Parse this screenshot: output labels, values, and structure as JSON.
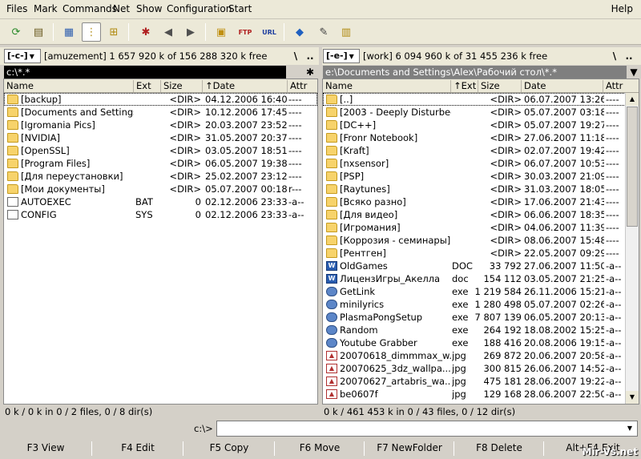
{
  "menu": [
    "Files",
    "Mark",
    "Commands",
    "Net",
    "Show",
    "Configuration",
    "Start"
  ],
  "menu_help": "Help",
  "left": {
    "drive": "[-c-]",
    "info": "[amuzement]  1 657 920 k of 156 288 320 k free",
    "path": "c:\\*.*",
    "columns": [
      "Name",
      "Ext",
      "Size",
      "↑Date",
      "Attr"
    ],
    "rows": [
      {
        "name": "[backup]",
        "ext": "",
        "size": "<DIR>",
        "date": "04.12.2006 16:40",
        "attr": "----",
        "type": "folder"
      },
      {
        "name": "[Documents and Settings]",
        "ext": "",
        "size": "<DIR>",
        "date": "10.12.2006 17:45",
        "attr": "----",
        "type": "folder"
      },
      {
        "name": "[Igromania Pics]",
        "ext": "",
        "size": "<DIR>",
        "date": "20.03.2007 23:52",
        "attr": "----",
        "type": "folder"
      },
      {
        "name": "[NVIDIA]",
        "ext": "",
        "size": "<DIR>",
        "date": "31.05.2007 20:37",
        "attr": "----",
        "type": "folder"
      },
      {
        "name": "[OpenSSL]",
        "ext": "",
        "size": "<DIR>",
        "date": "03.05.2007 18:51",
        "attr": "----",
        "type": "folder"
      },
      {
        "name": "[Program Files]",
        "ext": "",
        "size": "<DIR>",
        "date": "06.05.2007 19:38",
        "attr": "----",
        "type": "folder"
      },
      {
        "name": "[Для переустановки]",
        "ext": "",
        "size": "<DIR>",
        "date": "25.02.2007 23:12",
        "attr": "----",
        "type": "folder"
      },
      {
        "name": "[Мои документы]",
        "ext": "",
        "size": "<DIR>",
        "date": "05.07.2007 00:18",
        "attr": "r---",
        "type": "folder"
      },
      {
        "name": "AUTOEXEC",
        "ext": "BAT",
        "size": "0",
        "date": "02.12.2006 23:33",
        "attr": "-a--",
        "type": "file"
      },
      {
        "name": "CONFIG",
        "ext": "SYS",
        "size": "0",
        "date": "02.12.2006 23:33",
        "attr": "-a--",
        "type": "file"
      }
    ],
    "status": "0 k / 0 k in 0 / 2 files, 0 / 8 dir(s)"
  },
  "right": {
    "drive": "[-e-]",
    "info": "[work]  6 094 960 k of 31 455 236 k free",
    "path": "e:\\Documents and Settings\\Alex\\Рабочий стол\\*.*",
    "columns": [
      "Name",
      "↑Ext",
      "Size",
      "Date",
      "Attr"
    ],
    "rows": [
      {
        "name": "[..]",
        "ext": "",
        "size": "<DIR>",
        "date": "06.07.2007 13:26",
        "attr": "----",
        "type": "folder"
      },
      {
        "name": "[2003 - Deeply Disturbed]",
        "ext": "",
        "size": "<DIR>",
        "date": "05.07.2007 03:18",
        "attr": "----",
        "type": "folder"
      },
      {
        "name": "[DC++]",
        "ext": "",
        "size": "<DIR>",
        "date": "05.07.2007 19:27",
        "attr": "----",
        "type": "folder"
      },
      {
        "name": "[Fronr Notebook]",
        "ext": "",
        "size": "<DIR>",
        "date": "27.06.2007 11:18",
        "attr": "----",
        "type": "folder"
      },
      {
        "name": "[Kraft]",
        "ext": "",
        "size": "<DIR>",
        "date": "02.07.2007 19:42",
        "attr": "----",
        "type": "folder"
      },
      {
        "name": "[nxsensor]",
        "ext": "",
        "size": "<DIR>",
        "date": "06.07.2007 10:53",
        "attr": "----",
        "type": "folder"
      },
      {
        "name": "[PSP]",
        "ext": "",
        "size": "<DIR>",
        "date": "30.03.2007 21:09",
        "attr": "----",
        "type": "folder"
      },
      {
        "name": "[Raytunes]",
        "ext": "",
        "size": "<DIR>",
        "date": "31.03.2007 18:05",
        "attr": "----",
        "type": "folder"
      },
      {
        "name": "[Всяко разно]",
        "ext": "",
        "size": "<DIR>",
        "date": "17.06.2007 21:43",
        "attr": "----",
        "type": "folder"
      },
      {
        "name": "[Для видео]",
        "ext": "",
        "size": "<DIR>",
        "date": "06.06.2007 18:35",
        "attr": "----",
        "type": "folder"
      },
      {
        "name": "[Игромания]",
        "ext": "",
        "size": "<DIR>",
        "date": "04.06.2007 11:39",
        "attr": "----",
        "type": "folder"
      },
      {
        "name": "[Коррозия - семинары]",
        "ext": "",
        "size": "<DIR>",
        "date": "08.06.2007 15:48",
        "attr": "----",
        "type": "folder"
      },
      {
        "name": "[Рентген]",
        "ext": "",
        "size": "<DIR>",
        "date": "22.05.2007 09:29",
        "attr": "----",
        "type": "folder"
      },
      {
        "name": "OldGames",
        "ext": "DOC",
        "size": "33 792",
        "date": "27.06.2007 11:50",
        "attr": "-a--",
        "type": "doc"
      },
      {
        "name": "ЛицензИгры_Акелла",
        "ext": "doc",
        "size": "154 112",
        "date": "03.05.2007 21:25",
        "attr": "-a--",
        "type": "doc"
      },
      {
        "name": "GetLink",
        "ext": "exe",
        "size": "1 219 584",
        "date": "26.11.2006 15:21",
        "attr": "-a--",
        "type": "exe"
      },
      {
        "name": "minilyrics",
        "ext": "exe",
        "size": "1 280 498",
        "date": "05.07.2007 02:26",
        "attr": "-a--",
        "type": "exe"
      },
      {
        "name": "PlasmaPongSetup",
        "ext": "exe",
        "size": "7 807 139",
        "date": "06.05.2007 20:13",
        "attr": "-a--",
        "type": "exe"
      },
      {
        "name": "Random",
        "ext": "exe",
        "size": "264 192",
        "date": "18.08.2002 15:25",
        "attr": "-a--",
        "type": "exe"
      },
      {
        "name": "Youtube Grabber",
        "ext": "exe",
        "size": "188 416",
        "date": "20.08.2006 19:15",
        "attr": "-a--",
        "type": "exe"
      },
      {
        "name": "20070618_dimmmax_w...",
        "ext": "jpg",
        "size": "269 872",
        "date": "20.06.2007 20:58",
        "attr": "-a--",
        "type": "jpg"
      },
      {
        "name": "20070625_3dz_wallpa...",
        "ext": "jpg",
        "size": "300 815",
        "date": "26.06.2007 14:52",
        "attr": "-a--",
        "type": "jpg"
      },
      {
        "name": "20070627_artabris_wa...",
        "ext": "jpg",
        "size": "475 181",
        "date": "28.06.2007 19:22",
        "attr": "-a--",
        "type": "jpg"
      },
      {
        "name": "be0607f",
        "ext": "jpg",
        "size": "129 168",
        "date": "28.06.2007 22:50",
        "attr": "-a--",
        "type": "jpg"
      }
    ],
    "status": "0 k / 461 453 k in 0 / 43 files, 0 / 12 dir(s)"
  },
  "cmdline": {
    "prompt": "c:\\>",
    "value": ""
  },
  "fkeys": [
    "F3 View",
    "F4 Edit",
    "F5 Copy",
    "F6 Move",
    "F7 NewFolder",
    "F8 Delete",
    "Alt+F4 Exit"
  ],
  "watermark": "Mir-Vs.net",
  "toolbar_icons": [
    "refresh-icon",
    "brief-view-icon",
    "icon-view-icon",
    "tree-view-icon",
    "sort-icon",
    "mark-icon",
    "back-icon",
    "forward-icon",
    "pack-icon",
    "ftp-icon",
    "url-icon",
    "copy-names-icon",
    "edit-icon",
    "notepad-icon"
  ]
}
